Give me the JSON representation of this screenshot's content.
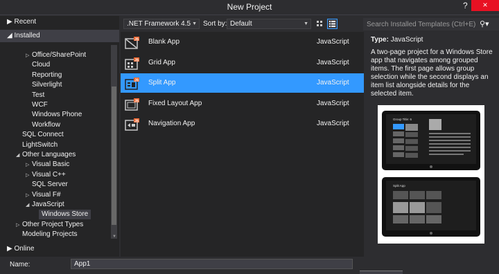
{
  "window": {
    "title": "New Project",
    "help": "?",
    "close": "×"
  },
  "tree": {
    "recent": "Recent",
    "installed": "Installed",
    "items": [
      {
        "label": "Office/SharePoint",
        "expandable": true
      },
      {
        "label": "Cloud",
        "expandable": false
      },
      {
        "label": "Reporting",
        "expandable": false
      },
      {
        "label": "Silverlight",
        "expandable": false
      },
      {
        "label": "Test",
        "expandable": false
      },
      {
        "label": "WCF",
        "expandable": false
      },
      {
        "label": "Windows Phone",
        "expandable": false
      },
      {
        "label": "Workflow",
        "expandable": false
      },
      {
        "label": "SQL Connect",
        "expandable": false
      },
      {
        "label": "LightSwitch",
        "expandable": false
      },
      {
        "label": "Other Languages",
        "expandable": true,
        "expanded": true
      },
      {
        "label": "Visual Basic",
        "expandable": true
      },
      {
        "label": "Visual C++",
        "expandable": true
      },
      {
        "label": "SQL Server",
        "expandable": false
      },
      {
        "label": "Visual F#",
        "expandable": true
      },
      {
        "label": "JavaScript",
        "expandable": true,
        "expanded": true
      },
      {
        "label": "Windows Store",
        "expandable": false,
        "selected": true
      },
      {
        "label": "Other Project Types",
        "expandable": true
      },
      {
        "label": "Modeling Projects",
        "expandable": false
      }
    ],
    "online": "Online"
  },
  "toolbar": {
    "framework": ".NET Framework 4.5",
    "sort_label": "Sort by:",
    "sort_value": "Default",
    "search_placeholder": "Search Installed Templates (Ctrl+E)"
  },
  "templates": [
    {
      "name": "Blank App",
      "language": "JavaScript",
      "icon": "blank-app-icon"
    },
    {
      "name": "Grid App",
      "language": "JavaScript",
      "icon": "grid-app-icon"
    },
    {
      "name": "Split App",
      "language": "JavaScript",
      "icon": "split-app-icon",
      "selected": true
    },
    {
      "name": "Fixed Layout App",
      "language": "JavaScript",
      "icon": "fixed-layout-app-icon"
    },
    {
      "name": "Navigation App",
      "language": "JavaScript",
      "icon": "navigation-app-icon"
    }
  ],
  "info": {
    "type_label": "Type:",
    "type_value": "JavaScript",
    "description": "A two-page project for a Windows Store app that navigates among grouped items. The first page allows group selection while the second displays an item list alongside details for the selected item.",
    "preview_top_title": "Group Title: 6",
    "preview_bottom_title": "Split App"
  },
  "form": {
    "name_label": "Name:",
    "name_value": "App1"
  },
  "colors": {
    "selection": "#3399ff",
    "background": "#2d2d30",
    "panel": "#252526",
    "close": "#e81123",
    "js_badge": "#f0652f"
  }
}
